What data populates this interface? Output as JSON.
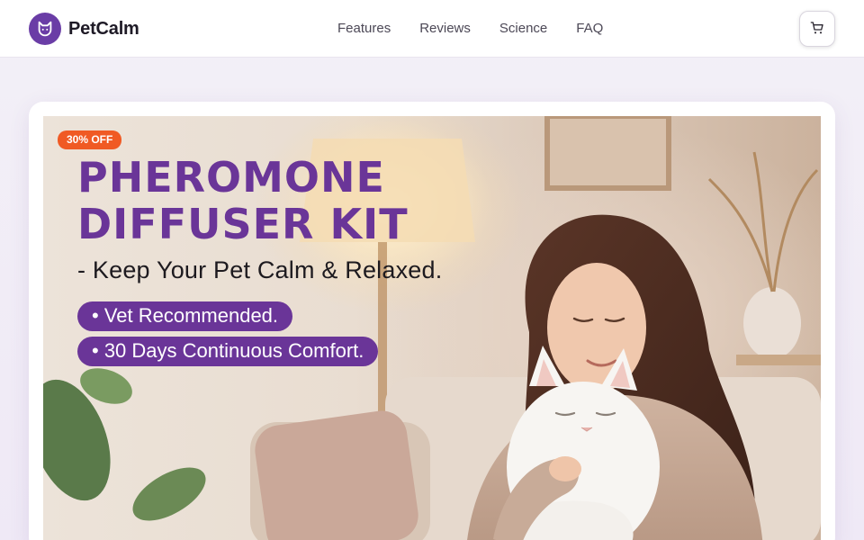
{
  "brand": {
    "name": "PetCalm",
    "accent": "#6a3da6",
    "logo_icon": "cat-face-icon"
  },
  "nav": {
    "items": [
      {
        "label": "Features"
      },
      {
        "label": "Reviews"
      },
      {
        "label": "Science"
      },
      {
        "label": "FAQ"
      }
    ]
  },
  "cart": {
    "icon": "shopping-cart-icon"
  },
  "hero": {
    "badge": "30% OFF",
    "badge_color": "#f05a24",
    "title_line1": "PHEROMONE",
    "title_line2": "DIFFUSER KIT",
    "title_color": "#6a3598",
    "subtitle": "- Keep Your Pet Calm & Relaxed.",
    "bullets": [
      "• Vet Recommended.",
      "• 30 Days Continuous Comfort."
    ],
    "image_subject": "woman-hugging-white-cat-photo"
  }
}
